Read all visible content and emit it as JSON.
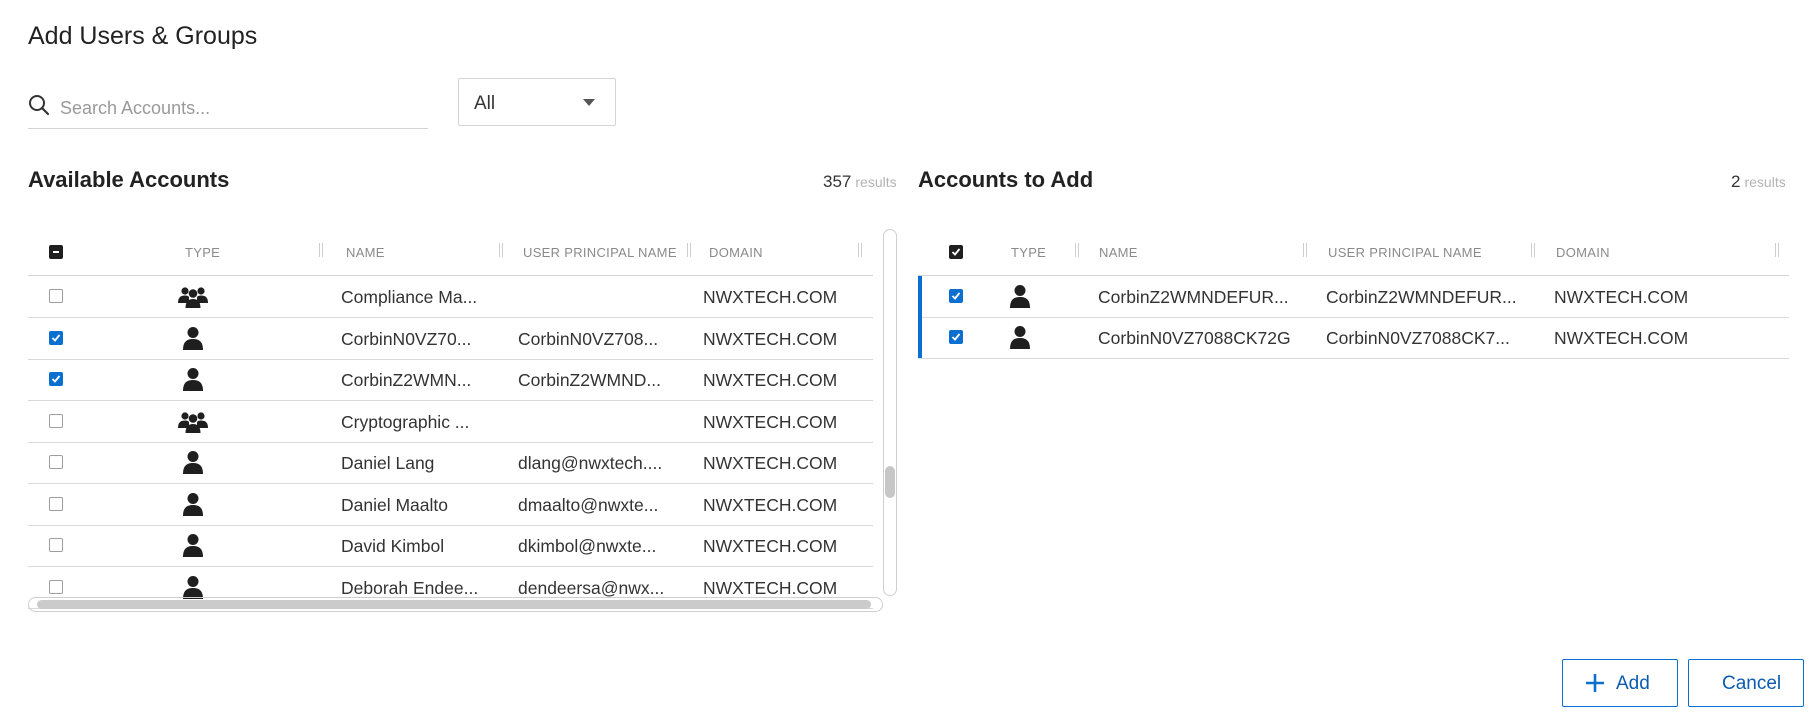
{
  "dialog": {
    "title": "Add Users & Groups"
  },
  "search": {
    "placeholder": "Search Accounts...",
    "value": ""
  },
  "filter": {
    "selected": "All"
  },
  "available": {
    "title": "Available Accounts",
    "count": "357",
    "count_suffix": "results",
    "columns": {
      "type": "TYPE",
      "name": "NAME",
      "upn": "USER PRINCIPAL NAME",
      "domain": "DOMAIN"
    },
    "rows": [
      {
        "checked": false,
        "type": "group",
        "name": "Compliance Ma...",
        "upn": "",
        "domain": "NWXTECH.COM"
      },
      {
        "checked": true,
        "type": "user",
        "name": "CorbinN0VZ70...",
        "upn": "CorbinN0VZ708...",
        "domain": "NWXTECH.COM"
      },
      {
        "checked": true,
        "type": "user",
        "name": "CorbinZ2WMN...",
        "upn": "CorbinZ2WMND...",
        "domain": "NWXTECH.COM"
      },
      {
        "checked": false,
        "type": "group",
        "name": "Cryptographic ...",
        "upn": "",
        "domain": "NWXTECH.COM"
      },
      {
        "checked": false,
        "type": "user",
        "name": "Daniel Lang",
        "upn": "dlang@nwxtech....",
        "domain": "NWXTECH.COM"
      },
      {
        "checked": false,
        "type": "user",
        "name": "Daniel Maalto",
        "upn": "dmaalto@nwxte...",
        "domain": "NWXTECH.COM"
      },
      {
        "checked": false,
        "type": "user",
        "name": "David Kimbol",
        "upn": "dkimbol@nwxte...",
        "domain": "NWXTECH.COM"
      },
      {
        "checked": false,
        "type": "user",
        "name": "Deborah Endee...",
        "upn": "dendeersa@nwx...",
        "domain": "NWXTECH.COM"
      }
    ]
  },
  "to_add": {
    "title": "Accounts to Add",
    "count": "2",
    "count_suffix": "results",
    "columns": {
      "type": "TYPE",
      "name": "NAME",
      "upn": "USER PRINCIPAL NAME",
      "domain": "DOMAIN"
    },
    "rows": [
      {
        "checked": true,
        "type": "user",
        "name": "CorbinZ2WMNDEFUR...",
        "upn": "CorbinZ2WMNDEFUR...",
        "domain": "NWXTECH.COM"
      },
      {
        "checked": true,
        "type": "user",
        "name": "CorbinN0VZ7088CK72G",
        "upn": "CorbinN0VZ7088CK7...",
        "domain": "NWXTECH.COM"
      }
    ]
  },
  "buttons": {
    "add": "Add",
    "cancel": "Cancel"
  },
  "colors": {
    "accent": "#0b6fd0",
    "header_checkbox": "#1f1f1f"
  },
  "icons": {
    "user": "person-icon",
    "group": "group-icon",
    "search": "search-icon",
    "add": "plus-icon"
  }
}
